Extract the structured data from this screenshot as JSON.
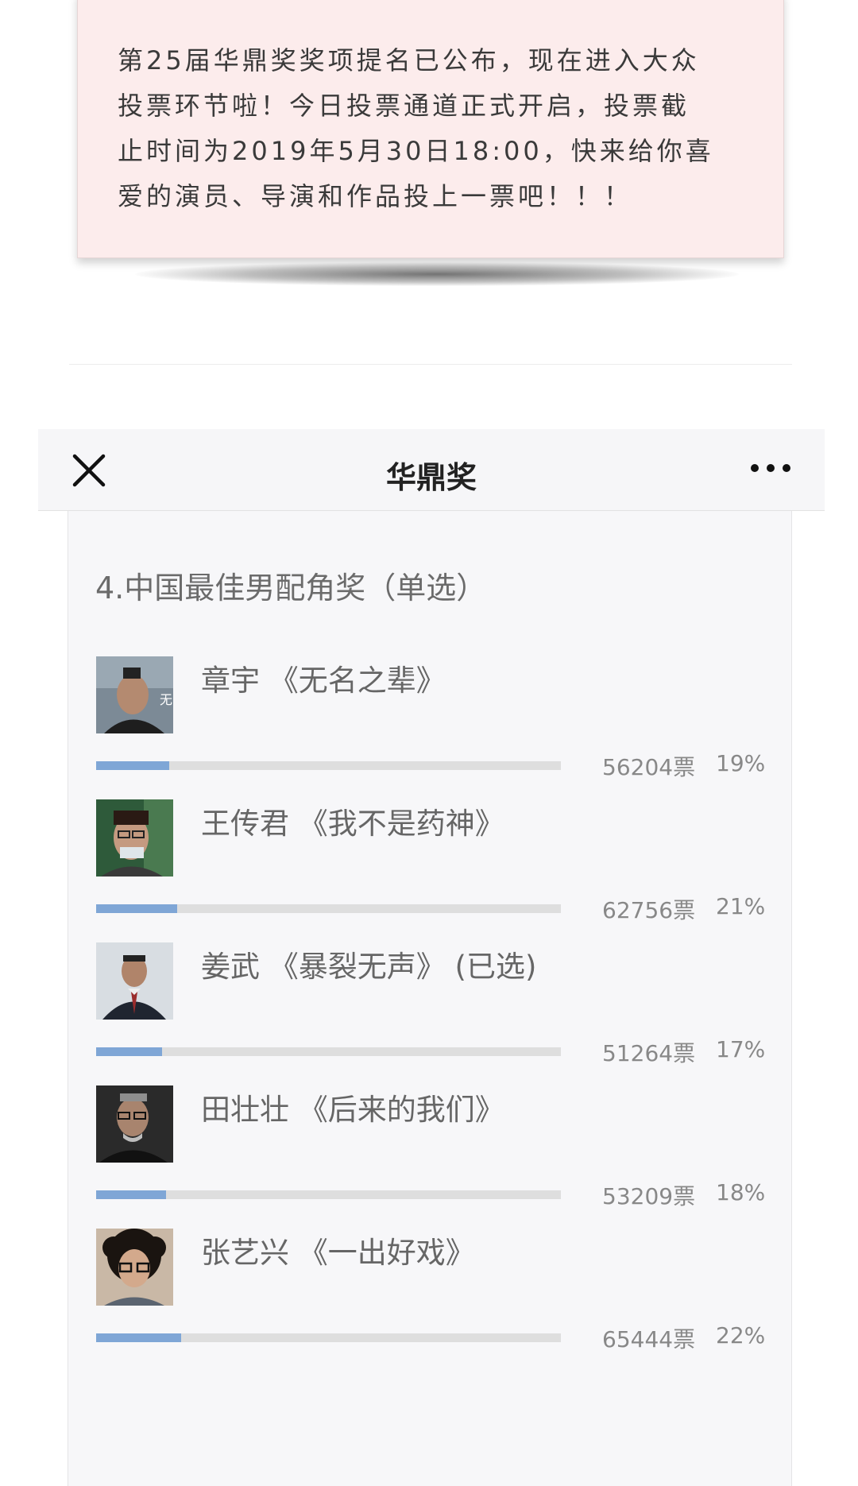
{
  "notice": {
    "line1": "第25届华鼎奖奖项提名已公布，现在进入大众",
    "line2": "投票环节啦！今日投票通道正式开启，投票截",
    "line3": "止时间为2019年5月30日18:00，快来给你喜",
    "line4": "爱的演员、导演和作品投上一票吧！！！"
  },
  "header": {
    "title": "华鼎奖",
    "close_icon": "close-icon",
    "more_icon": "more-icon"
  },
  "poll": {
    "question": "4.中国最佳男配角奖（单选）",
    "bar_color": "#7fa6d6",
    "options": [
      {
        "label": "章宇 《无名之辈》",
        "votes": "56204票",
        "percent": "19%",
        "fraction": 0.19
      },
      {
        "label": "王传君 《我不是药神》",
        "votes": "62756票",
        "percent": "21%",
        "fraction": 0.21
      },
      {
        "label": "姜武 《暴裂无声》 (已选)",
        "votes": "51264票",
        "percent": "17%",
        "fraction": 0.17
      },
      {
        "label": "田壮壮 《后来的我们》",
        "votes": "53209票",
        "percent": "18%",
        "fraction": 0.18
      },
      {
        "label": "张艺兴 《一出好戏》",
        "votes": "65444票",
        "percent": "22%",
        "fraction": 0.22
      }
    ]
  }
}
